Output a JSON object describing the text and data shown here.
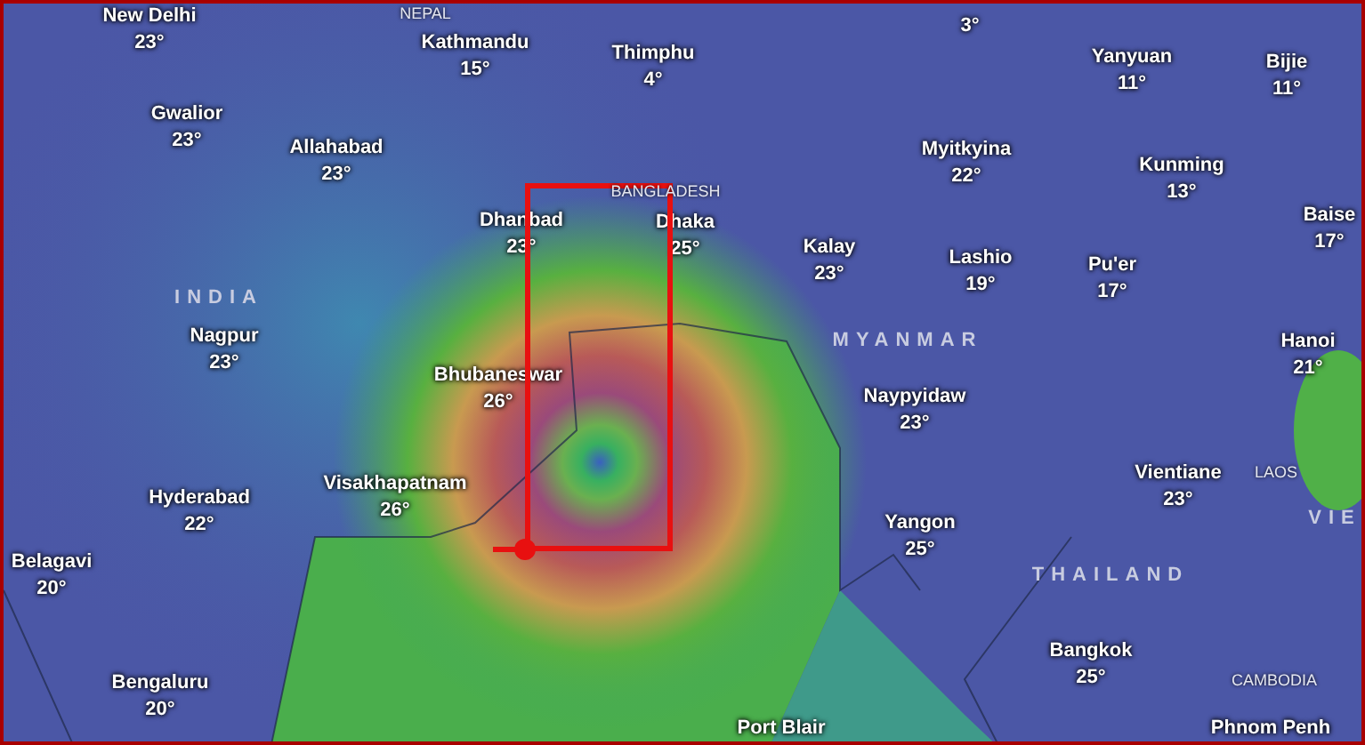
{
  "labels": [
    {
      "kind": "city",
      "name": "New Delhi",
      "temp": "23°"
    },
    {
      "kind": "smallcountry",
      "name": "NEPAL"
    },
    {
      "kind": "city",
      "name": "Kathmandu",
      "temp": "15°"
    },
    {
      "kind": "city",
      "name": "Thimphu",
      "temp": "4°"
    },
    {
      "kind": "city",
      "temp": "3°"
    },
    {
      "kind": "city",
      "name": "Gwalior",
      "temp": "23°"
    },
    {
      "kind": "city",
      "name": "Allahabad",
      "temp": "23°"
    },
    {
      "kind": "city",
      "name": "Yanyuan",
      "temp": "11°"
    },
    {
      "kind": "city",
      "name": "Bijie",
      "temp": "11°"
    },
    {
      "kind": "smallcountry",
      "name": "BANGLADESH"
    },
    {
      "kind": "city",
      "name": "Myitkyina",
      "temp": "22°"
    },
    {
      "kind": "city",
      "name": "Kunming",
      "temp": "13°"
    },
    {
      "kind": "city",
      "name": "Dhanbad",
      "temp": "23°"
    },
    {
      "kind": "city",
      "name": "Dhaka",
      "temp": "25°"
    },
    {
      "kind": "city",
      "name": "Kalay",
      "temp": "23°"
    },
    {
      "kind": "city",
      "name": "Lashio",
      "temp": "19°"
    },
    {
      "kind": "city",
      "name": "Pu'er",
      "temp": "17°"
    },
    {
      "kind": "city",
      "name": "Baise",
      "temp": "17°"
    },
    {
      "kind": "country",
      "name": "INDIA"
    },
    {
      "kind": "city",
      "name": "Nagpur",
      "temp": "23°"
    },
    {
      "kind": "country",
      "name": "MYANMAR"
    },
    {
      "kind": "city",
      "name": "Hanoi",
      "temp": "21°"
    },
    {
      "kind": "city",
      "name": "Bhubaneswar",
      "temp": "26°"
    },
    {
      "kind": "city",
      "name": "Naypyidaw",
      "temp": "23°"
    },
    {
      "kind": "city",
      "name": "Vientiane",
      "temp": "23°"
    },
    {
      "kind": "smallcountry",
      "name": "LAOS"
    },
    {
      "kind": "city",
      "name": "Visakhapatnam",
      "temp": "26°"
    },
    {
      "kind": "city",
      "name": "Hyderabad",
      "temp": "22°"
    },
    {
      "kind": "city",
      "name": "Yangon",
      "temp": "25°"
    },
    {
      "kind": "country",
      "name": "VIE"
    },
    {
      "kind": "city",
      "name": "Belagavi",
      "temp": "20°"
    },
    {
      "kind": "country",
      "name": "THAILAND"
    },
    {
      "kind": "city",
      "name": "Bangkok",
      "temp": "25°"
    },
    {
      "kind": "city",
      "name": "Bengaluru",
      "temp": "20°"
    },
    {
      "kind": "smallcountry",
      "name": "CAMBODIA"
    },
    {
      "kind": "city",
      "name": "Port Blair"
    },
    {
      "kind": "city",
      "name": "Phnom Penh"
    }
  ]
}
